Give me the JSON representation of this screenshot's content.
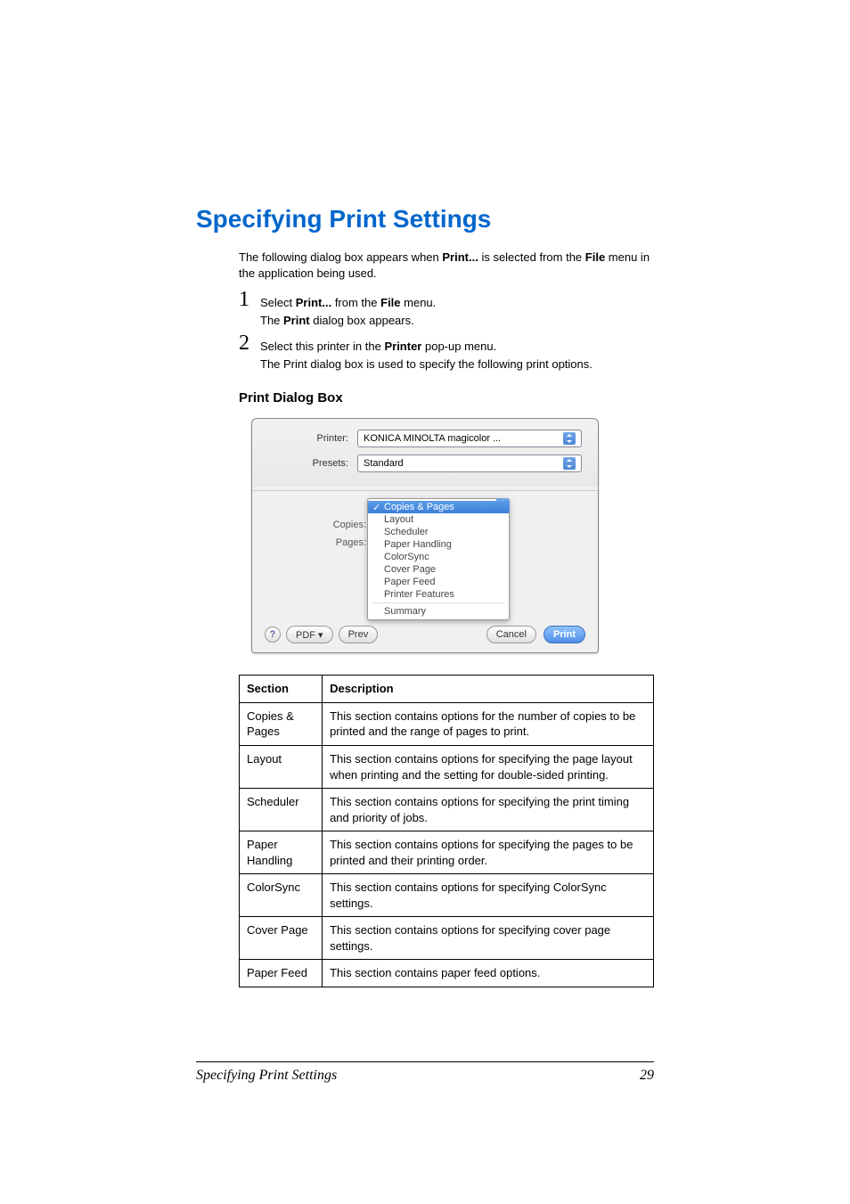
{
  "heading": "Specifying Print Settings",
  "intro_pre": "The following dialog box appears when ",
  "intro_bold1": "Print...",
  "intro_mid": " is selected from the ",
  "intro_bold2": "File",
  "intro_end": " menu in the application being used.",
  "step1": {
    "num": "1",
    "a": "Select ",
    "b": "Print...",
    "c": " from the ",
    "d": "File",
    "e": " menu.",
    "sub_a": "The ",
    "sub_b": "Print",
    "sub_c": " dialog box appears."
  },
  "step2": {
    "num": "2",
    "a": "Select this printer in the ",
    "b": "Printer",
    "c": " pop-up menu.",
    "sub": "The Print dialog box is used to specify the following print options."
  },
  "subheading": "Print Dialog Box",
  "dialog": {
    "printer_label": "Printer:",
    "printer_value": "KONICA MINOLTA magicolor ...",
    "presets_label": "Presets:",
    "presets_value": "Standard",
    "copies_label": "Copies:",
    "pages_label": "Pages:",
    "menu": [
      "Copies & Pages",
      "Layout",
      "Scheduler",
      "Paper Handling",
      "ColorSync",
      "Cover Page",
      "Paper Feed",
      "Printer Features",
      "Summary"
    ],
    "pdf": "PDF ▾",
    "preview": "Prev",
    "cancel": "Cancel",
    "print": "Print",
    "help": "?"
  },
  "table": {
    "h1": "Section",
    "h2": "Description",
    "rows": [
      {
        "s": "Copies & Pages",
        "d": "This section contains options for the number of copies to be printed and the range of pages to print."
      },
      {
        "s": "Layout",
        "d": "This section contains options for specifying the page layout when printing and the setting for double-sided printing."
      },
      {
        "s": "Scheduler",
        "d": "This section contains options for specifying the print timing and priority of jobs."
      },
      {
        "s": "Paper Handling",
        "d": "This section contains options for specifying the pages to be printed and their printing order."
      },
      {
        "s": "ColorSync",
        "d": "This section contains options for specifying ColorSync settings."
      },
      {
        "s": "Cover Page",
        "d": "This section contains options for specifying cover page settings."
      },
      {
        "s": "Paper Feed",
        "d": "This section contains paper feed options."
      }
    ]
  },
  "footer_text": "Specifying Print Settings",
  "page_number": "29"
}
